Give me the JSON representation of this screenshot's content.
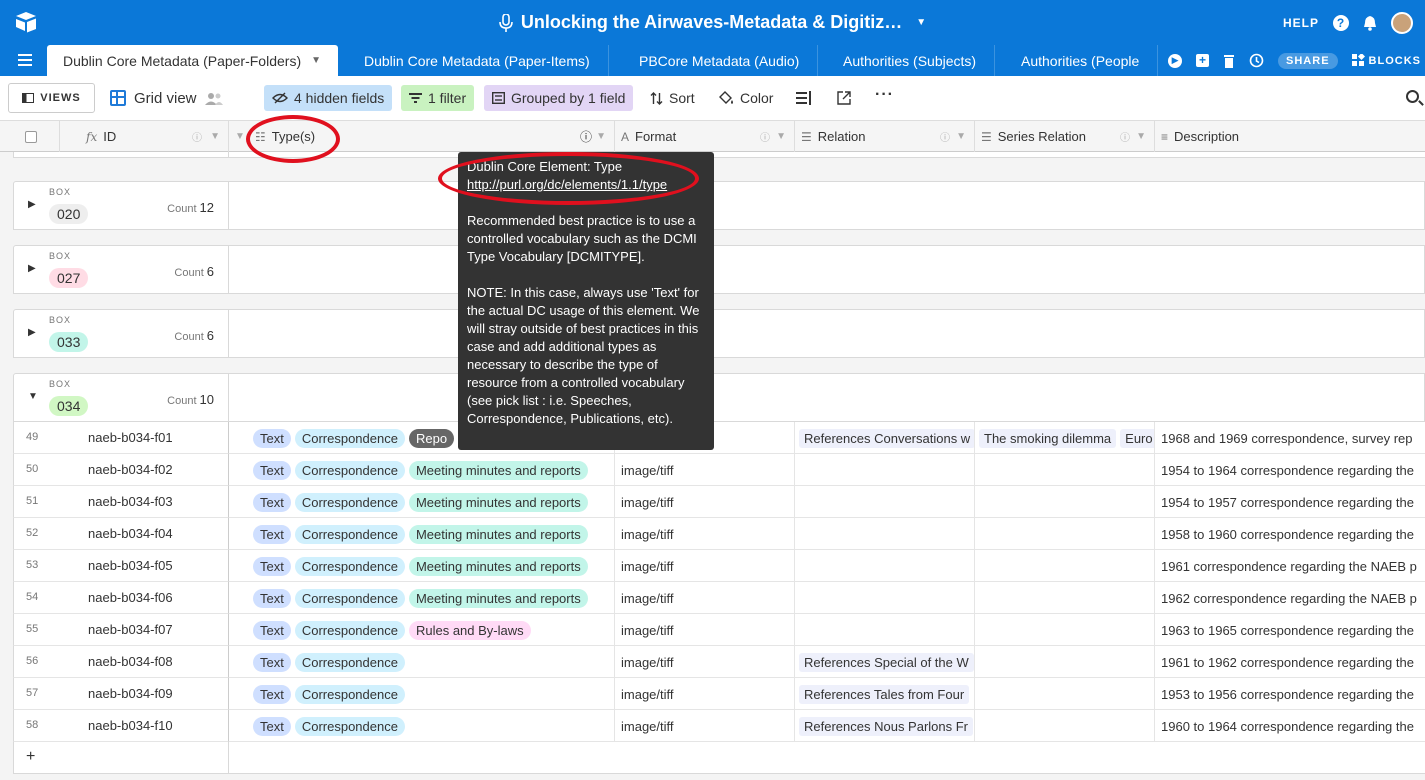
{
  "app": {
    "title": "Unlocking the Airwaves-Metadata & Digitiz…",
    "help_label": "HELP",
    "share_label": "SHARE",
    "blocks_label": "BLOCKS"
  },
  "tabs": [
    {
      "label": "Dublin Core Metadata (Paper-Folders)",
      "active": true
    },
    {
      "label": "Dublin Core Metadata (Paper-Items)"
    },
    {
      "label": "PBCore Metadata (Audio)"
    },
    {
      "label": "Authorities (Subjects)"
    },
    {
      "label": "Authorities (People"
    }
  ],
  "viewbar": {
    "views_label": "VIEWS",
    "view_name": "Grid view",
    "hidden_fields": "4 hidden fields",
    "filter": "1 filter",
    "grouped": "Grouped by 1 field",
    "sort": "Sort",
    "color": "Color"
  },
  "columns": {
    "id": "ID",
    "types": "Type(s)",
    "format": "Format",
    "relation": "Relation",
    "series_relation": "Series Relation",
    "description": "Description"
  },
  "groups": [
    {
      "label": "BOX",
      "value": "020",
      "count_label": "Count",
      "count": "12",
      "color": "#eeeeee",
      "expanded": false
    },
    {
      "label": "BOX",
      "value": "027",
      "count_label": "Count",
      "count": "6",
      "color": "#ffdce5",
      "expanded": false
    },
    {
      "label": "BOX",
      "value": "033",
      "count_label": "Count",
      "count": "6",
      "color": "#c2f5e9",
      "expanded": false
    },
    {
      "label": "BOX",
      "value": "034",
      "count_label": "Count",
      "count": "10",
      "color": "#d1f7c4",
      "expanded": true
    }
  ],
  "rows": [
    {
      "num": "49",
      "id": "naeb-b034-f01",
      "types": [
        "Text",
        "Correspondence",
        "Repo"
      ],
      "format": "",
      "relation": "References Conversations w",
      "series": "The smoking dilemma",
      "series2": "Euro",
      "description": "1968 and 1969 correspondence, survey rep"
    },
    {
      "num": "50",
      "id": "naeb-b034-f02",
      "types": [
        "Text",
        "Correspondence",
        "Meeting minutes and reports"
      ],
      "format": "image/tiff",
      "relation": "",
      "series": "",
      "description": "1954 to 1964 correspondence regarding the"
    },
    {
      "num": "51",
      "id": "naeb-b034-f03",
      "types": [
        "Text",
        "Correspondence",
        "Meeting minutes and reports"
      ],
      "format": "image/tiff",
      "relation": "",
      "series": "",
      "description": "1954 to 1957 correspondence regarding the"
    },
    {
      "num": "52",
      "id": "naeb-b034-f04",
      "types": [
        "Text",
        "Correspondence",
        "Meeting minutes and reports"
      ],
      "format": "image/tiff",
      "relation": "",
      "series": "",
      "description": "1958 to 1960 correspondence regarding the"
    },
    {
      "num": "53",
      "id": "naeb-b034-f05",
      "types": [
        "Text",
        "Correspondence",
        "Meeting minutes and reports"
      ],
      "format": "image/tiff",
      "relation": "",
      "series": "",
      "description": "1961 correspondence regarding the NAEB p"
    },
    {
      "num": "54",
      "id": "naeb-b034-f06",
      "types": [
        "Text",
        "Correspondence",
        "Meeting minutes and reports"
      ],
      "format": "image/tiff",
      "relation": "",
      "series": "",
      "description": "1962 correspondence regarding the NAEB p"
    },
    {
      "num": "55",
      "id": "naeb-b034-f07",
      "types": [
        "Text",
        "Correspondence",
        "Rules and By-laws"
      ],
      "format": "image/tiff",
      "relation": "",
      "series": "",
      "description": "1963 to 1965 correspondence regarding the"
    },
    {
      "num": "56",
      "id": "naeb-b034-f08",
      "types": [
        "Text",
        "Correspondence"
      ],
      "format": "image/tiff",
      "relation": "References Special of the W",
      "series": "",
      "description": "1961 to 1962 correspondence regarding the"
    },
    {
      "num": "57",
      "id": "naeb-b034-f09",
      "types": [
        "Text",
        "Correspondence"
      ],
      "format": "image/tiff",
      "relation": "References Tales from Four",
      "series": "",
      "description": "1953 to 1956 correspondence regarding the"
    },
    {
      "num": "58",
      "id": "naeb-b034-f10",
      "types": [
        "Text",
        "Correspondence"
      ],
      "format": "image/tiff",
      "relation": "References Nous Parlons Fr",
      "series": "",
      "description": "1960 to 1964 correspondence regarding the"
    }
  ],
  "add_row_label": "+",
  "tooltip": {
    "line1": "Dublin Core Element: Type",
    "link": "http://purl.org/dc/elements/1.1/type",
    "para1": "Recommended best practice is to use a controlled vocabulary such as the DCMI Type Vocabulary [DCMITYPE].",
    "para2": "NOTE: In this case, always use 'Text' for the actual DC usage of this element. We will stray outside of best practices in this case and add additional types as necessary to describe the type of resource from a controlled vocabulary (see pick list : i.e. Speeches, Correspondence, Publications, etc)."
  }
}
